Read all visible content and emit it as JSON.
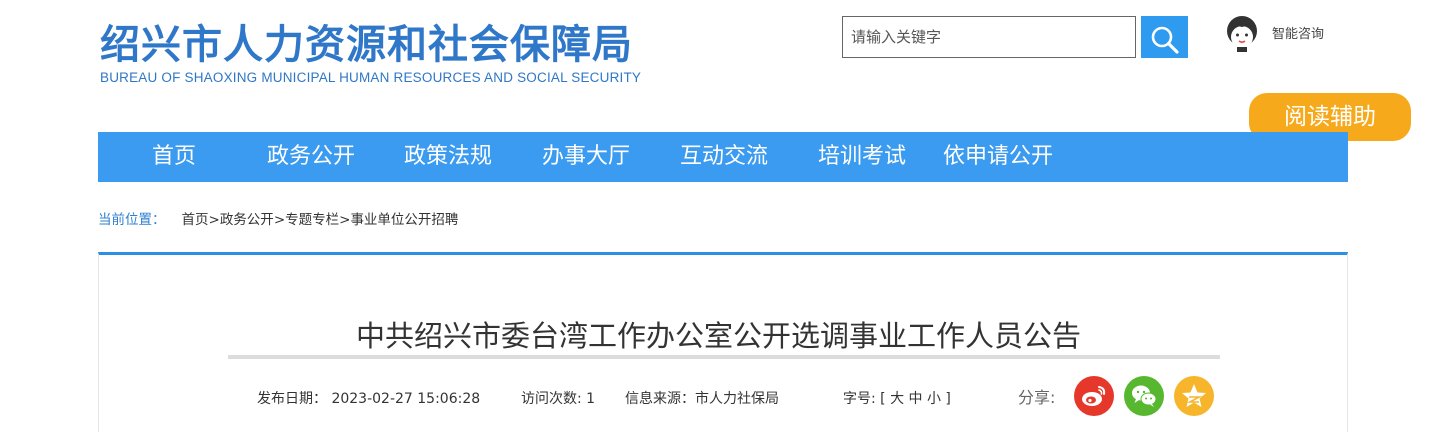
{
  "header": {
    "org_name_cn": "绍兴市人力资源和社会保障局",
    "org_name_en": "BUREAU OF SHAOXING MUNICIPAL HUMAN RESOURCES AND SOCIAL SECURITY",
    "search_placeholder": "请输入关键字",
    "consult_label": "智能咨询",
    "reading_assist": "阅读辅助"
  },
  "nav": {
    "items": [
      "首页",
      "政务公开",
      "政策法规",
      "办事大厅",
      "互动交流",
      "培训考试",
      "依申请公开"
    ]
  },
  "breadcrumb": {
    "label": "当前位置：",
    "items": [
      "首页",
      "政务公开",
      "专题专栏",
      "事业单位公开招聘"
    ],
    "separator": ">"
  },
  "article": {
    "title": "中共绍兴市委台湾工作办公室公开选调事业工作人员公告",
    "publish_date": "发布日期： 2023-02-27 15:06:28",
    "visits": "访问次数: 1",
    "source": "信息来源：市人力社保局",
    "font_size": "字号: [ 大 中 小 ]",
    "share_label": "分享:"
  },
  "icons": {
    "search": "search-icon",
    "consult": "assistant-avatar-icon",
    "share": [
      "weibo-icon",
      "wechat-icon",
      "qzone-icon"
    ]
  },
  "colors": {
    "brand_blue": "#2f77c8",
    "nav_blue": "#3b9bf0",
    "assist_orange": "#f7a91c",
    "weibo_red": "#e6372b",
    "wechat_green": "#57b830",
    "qzone_yellow": "#f6b52a"
  }
}
